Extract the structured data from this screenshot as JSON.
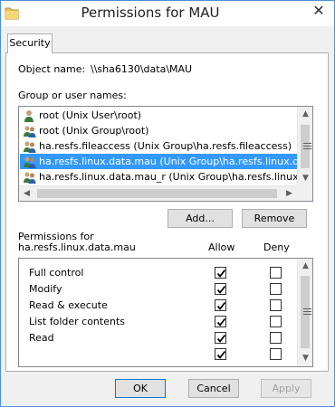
{
  "window": {
    "title": "Permissions for MAU",
    "close_glyph": "✕"
  },
  "tabs": [
    {
      "label": "Security"
    }
  ],
  "object": {
    "label": "Object name:",
    "value": "\\\\sha6130\\data\\MAU"
  },
  "groups": {
    "label": "Group or user names:",
    "items": [
      {
        "label": "root (Unix User\\root)",
        "icon": "user-icon"
      },
      {
        "label": "root (Unix Group\\root)",
        "icon": "group-icon"
      },
      {
        "label": "ha.resfs.fileaccess (Unix Group\\ha.resfs.fileaccess)",
        "icon": "group-icon"
      },
      {
        "label": "ha.resfs.linux.data.mau (Unix Group\\ha.resfs.linux.data.mau)",
        "icon": "group-icon",
        "selected": true
      },
      {
        "label": "ha.resfs.linux.data.mau_r (Unix Group\\ha.resfs.linux.data.mau_r)",
        "icon": "group-icon"
      }
    ],
    "add_label": "Add...",
    "remove_label": "Remove"
  },
  "permissions": {
    "label_line1": "Permissions for",
    "label_line2": "ha.resfs.linux.data.mau",
    "allow_header": "Allow",
    "deny_header": "Deny",
    "rows": [
      {
        "name": "Full control",
        "allow": true,
        "deny": false
      },
      {
        "name": "Modify",
        "allow": true,
        "deny": false
      },
      {
        "name": "Read & execute",
        "allow": true,
        "deny": false
      },
      {
        "name": "List folder contents",
        "allow": true,
        "deny": false
      },
      {
        "name": "Read",
        "allow": true,
        "deny": false
      },
      {
        "name": "",
        "allow": true,
        "deny": false
      }
    ]
  },
  "footer": {
    "ok_label": "OK",
    "cancel_label": "Cancel",
    "apply_label": "Apply"
  },
  "colors": {
    "selection": "#3399ff",
    "accent": "#0078d7"
  }
}
